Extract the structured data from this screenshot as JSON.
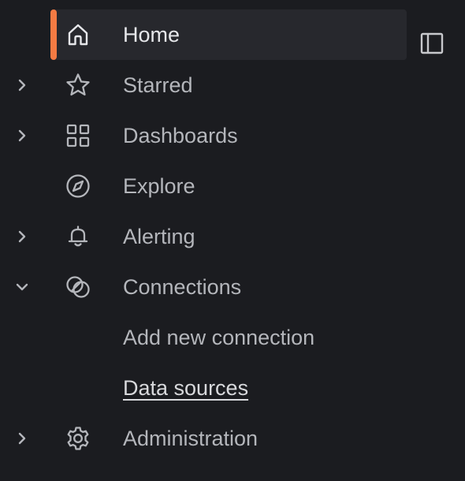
{
  "nav": {
    "items": [
      {
        "label": "Home",
        "icon": "home-icon",
        "active": true
      },
      {
        "label": "Starred",
        "icon": "star-icon",
        "expandable": true
      },
      {
        "label": "Dashboards",
        "icon": "apps-grid-icon",
        "expandable": true
      },
      {
        "label": "Explore",
        "icon": "compass-icon"
      },
      {
        "label": "Alerting",
        "icon": "bell-icon",
        "expandable": true
      },
      {
        "label": "Connections",
        "icon": "connections-icon",
        "expanded": true
      },
      {
        "label": "Add new connection",
        "child": true
      },
      {
        "label": "Data sources",
        "child": true,
        "current": true
      },
      {
        "label": "Administration",
        "icon": "cog-icon",
        "expandable": true
      }
    ],
    "dock_icon": "dock-panel-icon"
  },
  "colors": {
    "background": "#1b1c20",
    "active_background": "#27282d",
    "active_indicator": "#f47b43",
    "text": "#b4b6bb",
    "text_active": "#e6e7ea"
  }
}
